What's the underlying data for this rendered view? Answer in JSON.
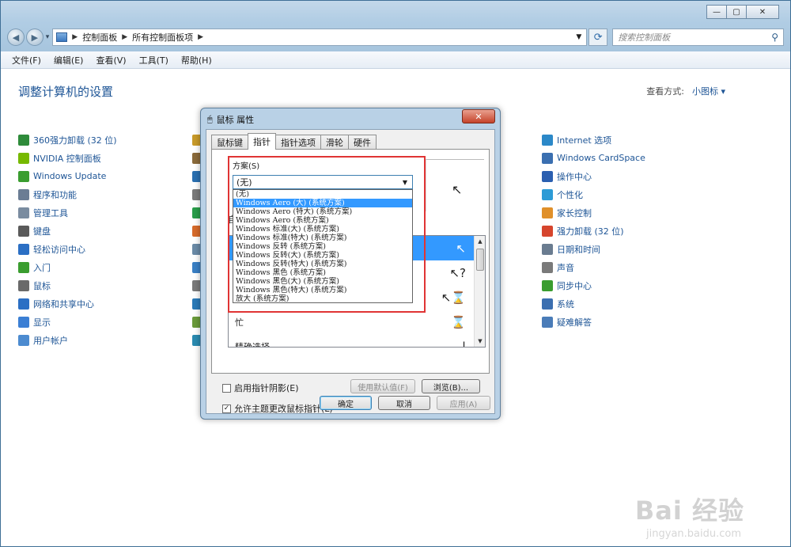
{
  "explorer": {
    "address": {
      "crumbs": [
        "控制面板",
        "所有控制面板项"
      ]
    },
    "search_placeholder": "搜索控制面板",
    "menu": [
      "文件(F)",
      "编辑(E)",
      "查看(V)",
      "工具(T)",
      "帮助(H)"
    ],
    "page_title": "调整计算机的设置",
    "view_by_label": "查看方式:",
    "view_by_value": "小图标 ▾"
  },
  "items_left": [
    {
      "label": "360强力卸载 (32 位)",
      "icon": "uninstall-icon",
      "color": "#2e8b3a"
    },
    {
      "label": "NVIDIA 控制面板",
      "icon": "nvidia-icon",
      "color": "#76b900"
    },
    {
      "label": "Windows Update",
      "icon": "windows-update-icon",
      "color": "#3a9d2f"
    },
    {
      "label": "程序和功能",
      "icon": "programs-icon",
      "color": "#6b7d94"
    },
    {
      "label": "管理工具",
      "icon": "admin-tools-icon",
      "color": "#7a8ca0"
    },
    {
      "label": "键盘",
      "icon": "keyboard-icon",
      "color": "#5a5a5a"
    },
    {
      "label": "轻松访问中心",
      "icon": "ease-of-access-icon",
      "color": "#2b6fc4"
    },
    {
      "label": "入门",
      "icon": "getting-started-icon",
      "color": "#3a9d2f"
    },
    {
      "label": "鼠标",
      "icon": "mouse-icon",
      "color": "#6a6a6a"
    },
    {
      "label": "网络和共享中心",
      "icon": "network-icon",
      "color": "#2b6fc4"
    },
    {
      "label": "显示",
      "icon": "display-icon",
      "color": "#3b7fd4"
    },
    {
      "label": "用户帐户",
      "icon": "user-accounts-icon",
      "color": "#4c8bd0"
    }
  ],
  "items_right": [
    {
      "label": "Internet 选项",
      "icon": "internet-options-icon",
      "color": "#2b88c8"
    },
    {
      "label": "Windows CardSpace",
      "icon": "cardspace-icon",
      "color": "#3a6fb0"
    },
    {
      "label": "操作中心",
      "icon": "action-center-icon",
      "color": "#2b5fb0"
    },
    {
      "label": "个性化",
      "icon": "personalization-icon",
      "color": "#2d9bd6"
    },
    {
      "label": "家长控制",
      "icon": "parental-controls-icon",
      "color": "#e0902a"
    },
    {
      "label": "强力卸载 (32 位)",
      "icon": "uninstall-color-icon",
      "color": "#d6452d"
    },
    {
      "label": "日期和时间",
      "icon": "date-time-icon",
      "color": "#6a7c90"
    },
    {
      "label": "声音",
      "icon": "sound-icon",
      "color": "#7a7a7a"
    },
    {
      "label": "同步中心",
      "icon": "sync-center-icon",
      "color": "#3a9d2f"
    },
    {
      "label": "系统",
      "icon": "system-icon",
      "color": "#3b6fb0"
    },
    {
      "label": "疑难解答",
      "icon": "troubleshooting-icon",
      "color": "#4a7cb8"
    }
  ],
  "dialog": {
    "title": "鼠标 属性",
    "close_label": "✕",
    "tabs": [
      "鼠标键",
      "指针",
      "指针选项",
      "滑轮",
      "硬件"
    ],
    "active_tab": 1,
    "scheme_label": "方案(S)",
    "scheme_value": "(无)",
    "scheme_options": [
      "(无)",
      "Windows Aero (大) (系统方案)",
      "Windows Aero (特大) (系统方案)",
      "Windows Aero (系统方案)",
      "Windows 标准(大) (系统方案)",
      "Windows 标准(特大) (系统方案)",
      "Windows 反转 (系统方案)",
      "Windows 反转(大) (系统方案)",
      "Windows 反转(特大) (系统方案)",
      "Windows 黑色 (系统方案)",
      "Windows 黑色(大) (系统方案)",
      "Windows 黑色(特大) (系统方案)",
      "放大 (系统方案)"
    ],
    "selected_option_index": 1,
    "custom_label": "自",
    "cursor_rows": [
      {
        "label": "",
        "glyph": "↖"
      },
      {
        "label": "",
        "glyph": "↖?"
      },
      {
        "label": "",
        "glyph": "↖⌛"
      },
      {
        "label": "忙",
        "glyph": "⌛"
      },
      {
        "label": "精确选择",
        "glyph": "|"
      }
    ],
    "shadow_label": "启用指针阴影(E)",
    "shadow_checked": "",
    "use_default_label": "使用默认值(F)",
    "browse_label": "浏览(B)...",
    "allow_theme_label": "允许主题更改鼠标指针(L)",
    "allow_theme_checked": "✓",
    "ok_label": "确定",
    "cancel_label": "取消",
    "apply_label": "应用(A)"
  },
  "watermark": {
    "main": "Bai 经验",
    "sub": "jingyan.baidu.com"
  }
}
